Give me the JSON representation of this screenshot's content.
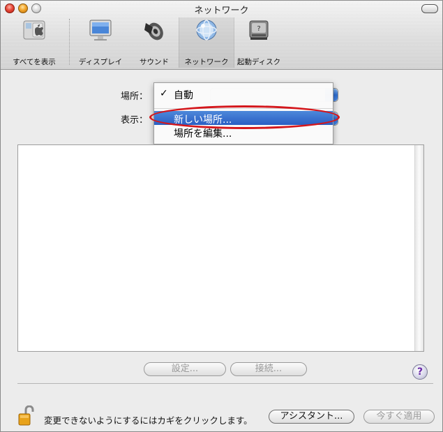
{
  "window": {
    "title": "ネットワーク"
  },
  "toolbar": {
    "items": [
      {
        "label": "すべてを表示",
        "icon": "apple-grid-icon"
      },
      {
        "label": "ディスプレイ",
        "icon": "display-icon"
      },
      {
        "label": "サウンド",
        "icon": "speaker-icon"
      },
      {
        "label": "ネットワーク",
        "icon": "network-globe-icon",
        "selected": true
      },
      {
        "label": "起動ディスク",
        "icon": "startup-disk-icon"
      }
    ]
  },
  "form": {
    "location_label": "場所：",
    "show_label": "表示："
  },
  "location_menu": {
    "items": [
      {
        "label": "自動",
        "checked": true
      },
      {
        "label": "新しい場所...",
        "highlighted": true
      },
      {
        "label": "場所を編集..."
      }
    ]
  },
  "buttons": {
    "configure": "設定...",
    "connect": "接続...",
    "assistant": "アシスタント...",
    "apply_now": "今すぐ適用",
    "help": "?"
  },
  "footer": {
    "lock_text": "変更できないようにするにはカギをクリックします。"
  },
  "colors": {
    "highlight": "#2f63c8",
    "annotation_ellipse": "#d4171c"
  }
}
